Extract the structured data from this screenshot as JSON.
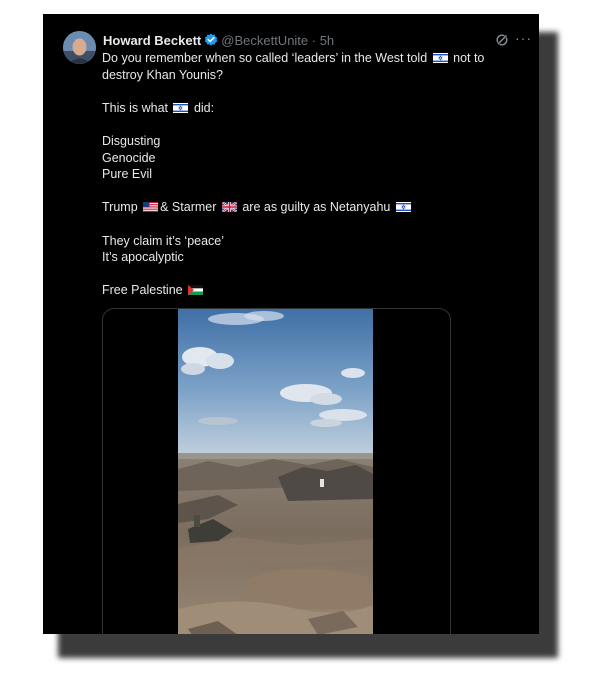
{
  "tweet": {
    "author_name": "Howard Beckett",
    "handle_time": "@BeckettUnite · 5h",
    "paragraphs": [
      {
        "name": "paragraph-leaders",
        "lines": [
          [
            {
              "t": "text",
              "v": "Do you remember when so called ‘leaders’ in the West told "
            },
            {
              "t": "flag",
              "v": "israel-flag"
            },
            {
              "t": "text",
              "v": " not to"
            }
          ],
          [
            {
              "t": "text",
              "v": "destroy Khan Younis?"
            }
          ]
        ]
      },
      {
        "name": "paragraph-this-is-what",
        "lines": [
          [
            {
              "t": "text",
              "v": "This is what "
            },
            {
              "t": "flag",
              "v": "israel-flag"
            },
            {
              "t": "text",
              "v": " did:"
            }
          ]
        ]
      },
      {
        "name": "paragraph-disgusting",
        "lines": [
          [
            {
              "t": "text",
              "v": "Disgusting"
            }
          ],
          [
            {
              "t": "text",
              "v": "Genocide"
            }
          ],
          [
            {
              "t": "text",
              "v": "Pure Evil"
            }
          ]
        ]
      },
      {
        "name": "paragraph-trump-starmer",
        "lines": [
          [
            {
              "t": "text",
              "v": "Trump "
            },
            {
              "t": "flag",
              "v": "usa-flag"
            },
            {
              "t": "text",
              "v": "& Starmer "
            },
            {
              "t": "flag",
              "v": "uk-flag"
            },
            {
              "t": "text",
              "v": " are as guilty as Netanyahu "
            },
            {
              "t": "flag",
              "v": "israel-flag"
            }
          ]
        ]
      },
      {
        "name": "paragraph-peace",
        "lines": [
          [
            {
              "t": "text",
              "v": "They claim it’s ‘peace’"
            }
          ],
          [
            {
              "t": "text",
              "v": "It’s apocalyptic"
            }
          ]
        ]
      },
      {
        "name": "paragraph-free-palestine",
        "lines": [
          [
            {
              "t": "text",
              "v": "Free Palestine "
            },
            {
              "t": "flag",
              "v": "palestine-flag"
            }
          ]
        ]
      }
    ]
  },
  "colors": {
    "background": "#000000",
    "text": "#e7e9ea",
    "muted": "#71767b",
    "verified": "#1d9bf0",
    "border": "#2f3336"
  },
  "icons": {
    "verified": "verified-badge-icon",
    "grok": "grok-icon",
    "more": "more-options-icon"
  }
}
